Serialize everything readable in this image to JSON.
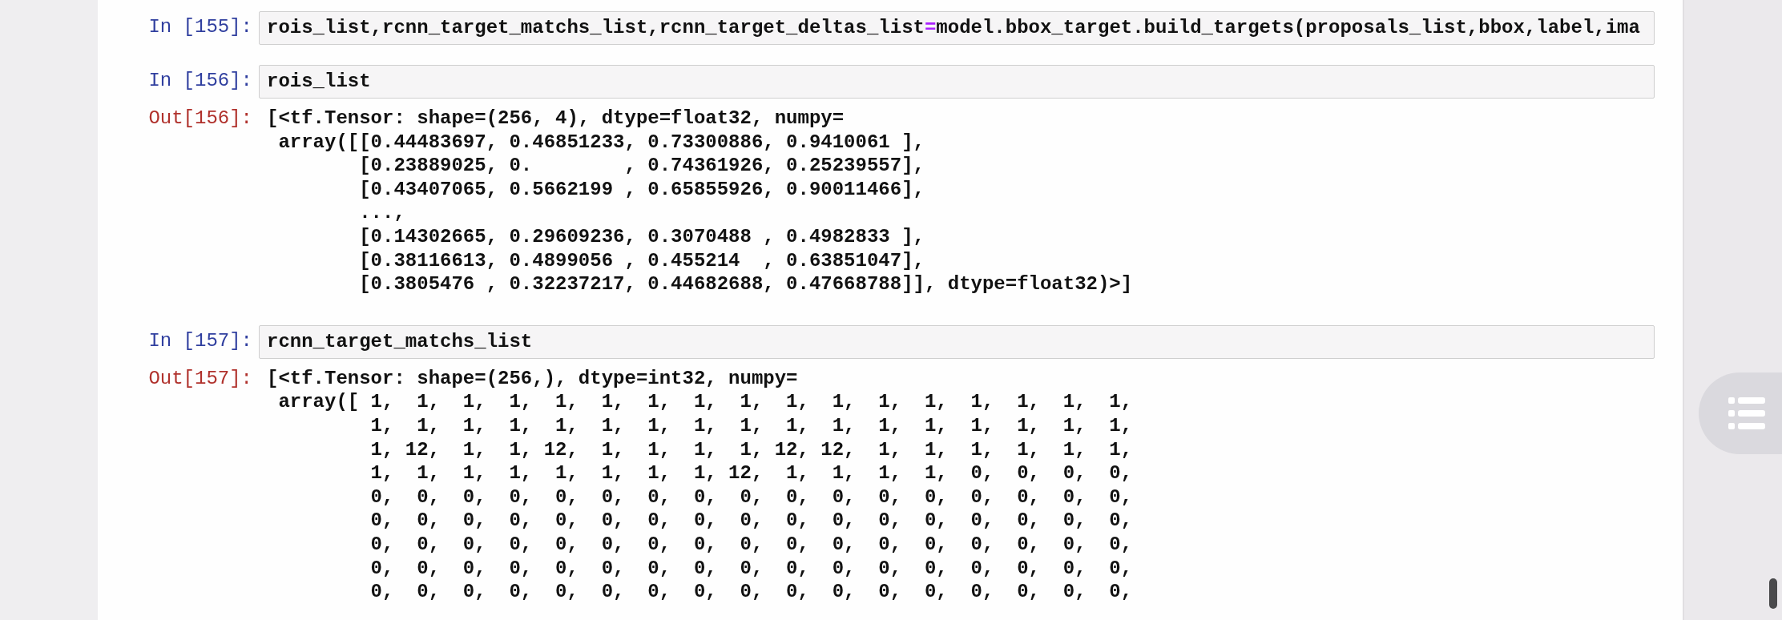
{
  "cells": [
    {
      "kind": "input",
      "prompt": "In [155]:",
      "code": [
        {
          "kind": "name",
          "text": "rois_list,rcnn_target_matchs_list,rcnn_target_deltas_list"
        },
        {
          "kind": "operator",
          "text": "="
        },
        {
          "kind": "name",
          "text": "model.bbox_target.build_targets(proposals_list,bbox,label,ima"
        }
      ]
    },
    {
      "kind": "input",
      "prompt": "In [156]:",
      "code": [
        {
          "kind": "name",
          "text": "rois_list"
        }
      ]
    },
    {
      "kind": "output",
      "prompt": "Out[156]:",
      "lines": [
        "[<tf.Tensor: shape=(256, 4), dtype=float32, numpy=",
        " array([[0.44483697, 0.46851233, 0.73300886, 0.9410061 ],",
        "        [0.23889025, 0.        , 0.74361926, 0.25239557],",
        "        [0.43407065, 0.5662199 , 0.65855926, 0.90011466],",
        "        ...,",
        "        [0.14302665, 0.29609236, 0.3070488 , 0.4982833 ],",
        "        [0.38116613, 0.4899056 , 0.455214  , 0.63851047],",
        "        [0.3805476 , 0.32237217, 0.44682688, 0.47668788]], dtype=float32)>]"
      ]
    },
    {
      "kind": "input",
      "prompt": "In [157]:",
      "code": [
        {
          "kind": "name",
          "text": "rcnn_target_matchs_list"
        }
      ]
    },
    {
      "kind": "output",
      "prompt": "Out[157]:",
      "lines": [
        "[<tf.Tensor: shape=(256,), dtype=int32, numpy=",
        " array([ 1,  1,  1,  1,  1,  1,  1,  1,  1,  1,  1,  1,  1,  1,  1,  1,  1,",
        "         1,  1,  1,  1,  1,  1,  1,  1,  1,  1,  1,  1,  1,  1,  1,  1,  1,",
        "         1, 12,  1,  1, 12,  1,  1,  1,  1, 12, 12,  1,  1,  1,  1,  1,  1,",
        "         1,  1,  1,  1,  1,  1,  1,  1, 12,  1,  1,  1,  1,  0,  0,  0,  0,",
        "         0,  0,  0,  0,  0,  0,  0,  0,  0,  0,  0,  0,  0,  0,  0,  0,  0,",
        "         0,  0,  0,  0,  0,  0,  0,  0,  0,  0,  0,  0,  0,  0,  0,  0,  0,",
        "         0,  0,  0,  0,  0,  0,  0,  0,  0,  0,  0,  0,  0,  0,  0,  0,  0,",
        "         0,  0,  0,  0,  0,  0,  0,  0,  0,  0,  0,  0,  0,  0,  0,  0,  0,",
        "         0,  0,  0,  0,  0,  0,  0,  0,  0,  0,  0,  0,  0,  0,  0,  0,  0,"
      ]
    }
  ]
}
